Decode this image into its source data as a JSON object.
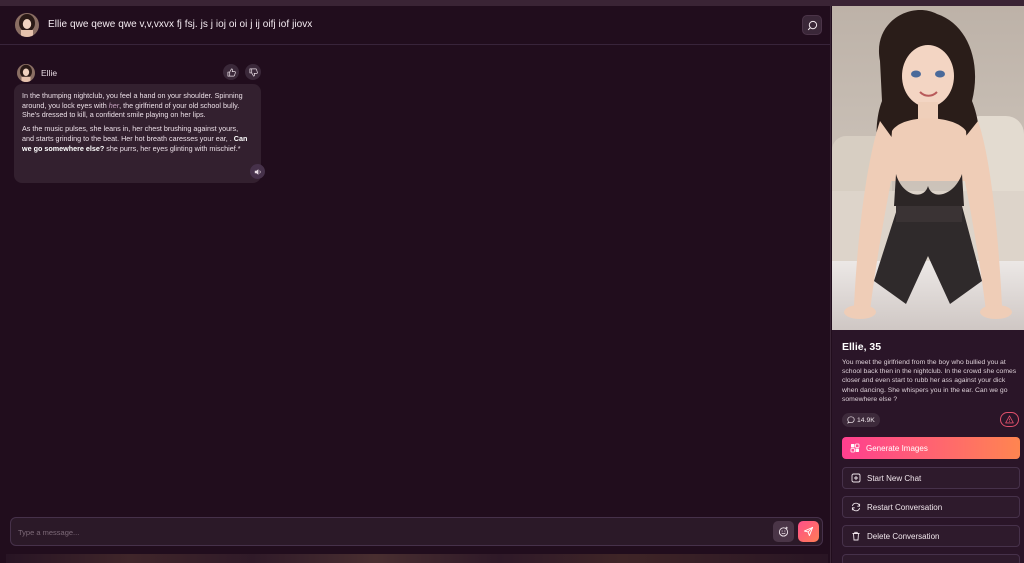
{
  "chat": {
    "title": "Ellie qwe qewe qwe v,v,vxvx fj fsj. js j ioj oi oi j ij oifj iof jiovx",
    "message": {
      "sender": "Ellie",
      "para1_a": "In the thumping nightclub, you feel a hand on your shoulder. Spinning around, you lock eyes with ",
      "para1_her": "her",
      "para1_b": ", the girlfriend of your old school bully. She's dressed to kill, a confident smile playing on her lips.",
      "para2_a": "As the music pulses, she leans in, her chest brushing against yours, and starts grinding to the beat. Her hot breath caresses your ear, . ",
      "para2_bold": "Can we go somewhere else?",
      "para2_b": " she purrs, her eyes glinting with mischief.*"
    },
    "input_placeholder": "Type a message..."
  },
  "profile": {
    "name": "Ellie, 35",
    "description": "You meet the girlfriend from the boy who bullied you at school back then in the nightclub. In the crowd she comes closer and even start to rubb her ass against your dick when dancing. She whispers you in the ear. Can we go somewhere else ?",
    "message_count": "14.9K",
    "buttons": {
      "generate": "Generate Images",
      "new_chat": "Start New Chat",
      "restart": "Restart Conversation",
      "delete": "Delete Conversation"
    }
  },
  "colors": {
    "background": "#210d1d",
    "panel": "#2a1528",
    "accent_start": "#ff3f8f",
    "accent_end": "#ff8550",
    "report": "#e0506b"
  },
  "icons": [
    "avatar",
    "history-icon",
    "thumbs-up-icon",
    "thumbs-down-icon",
    "speaker-icon",
    "emoji-icon",
    "send-icon",
    "chat-bubble-icon",
    "warning-icon",
    "image-gallery-icon",
    "plus-square-icon",
    "refresh-icon",
    "trash-icon"
  ]
}
